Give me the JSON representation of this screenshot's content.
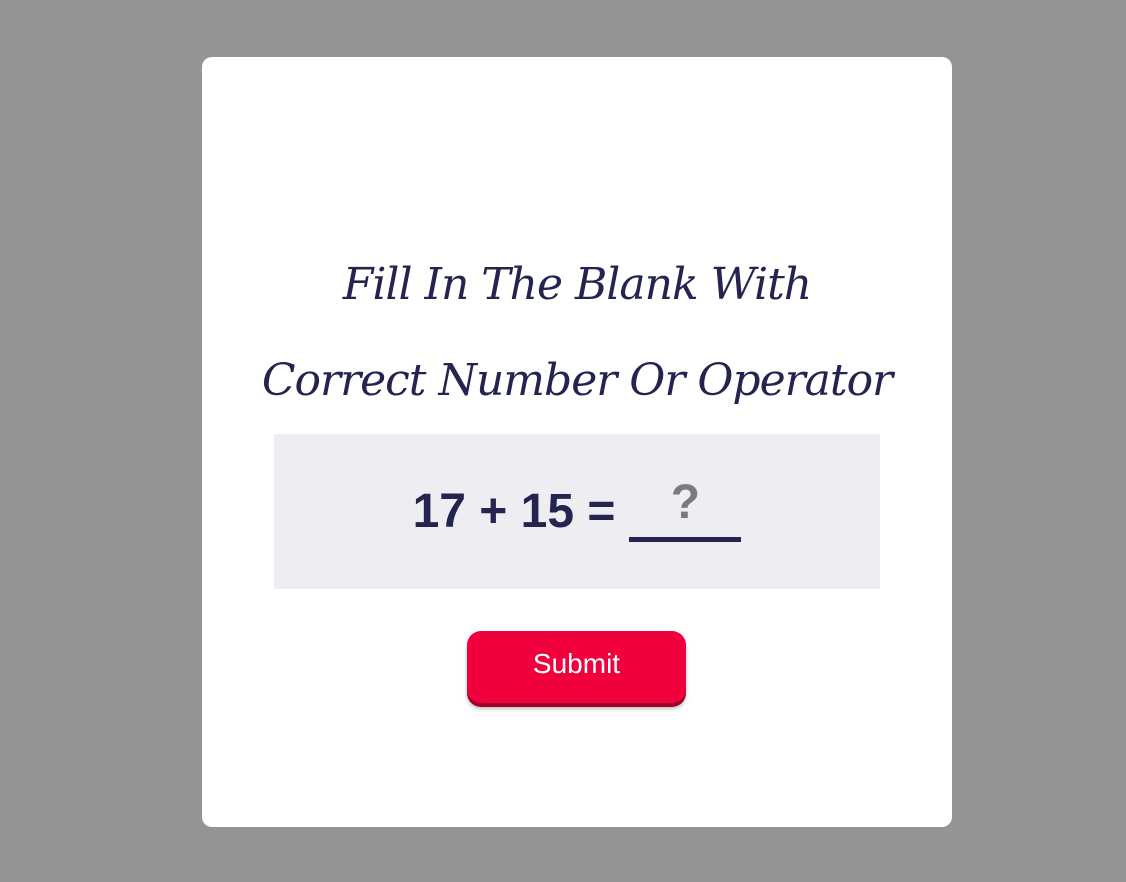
{
  "card": {
    "title_lines": [
      "Fill In The Blank With",
      "Correct Number Or Operator"
    ]
  },
  "equation": {
    "expression": "17 + 15 =",
    "blank_placeholder": "?"
  },
  "submit": {
    "label": "Submit"
  },
  "colors": {
    "background": "#949494",
    "card": "#ffffff",
    "text": "#23244f",
    "panel": "#eeedf2",
    "button": "#f0003c",
    "placeholder": "#7b7b7b"
  }
}
